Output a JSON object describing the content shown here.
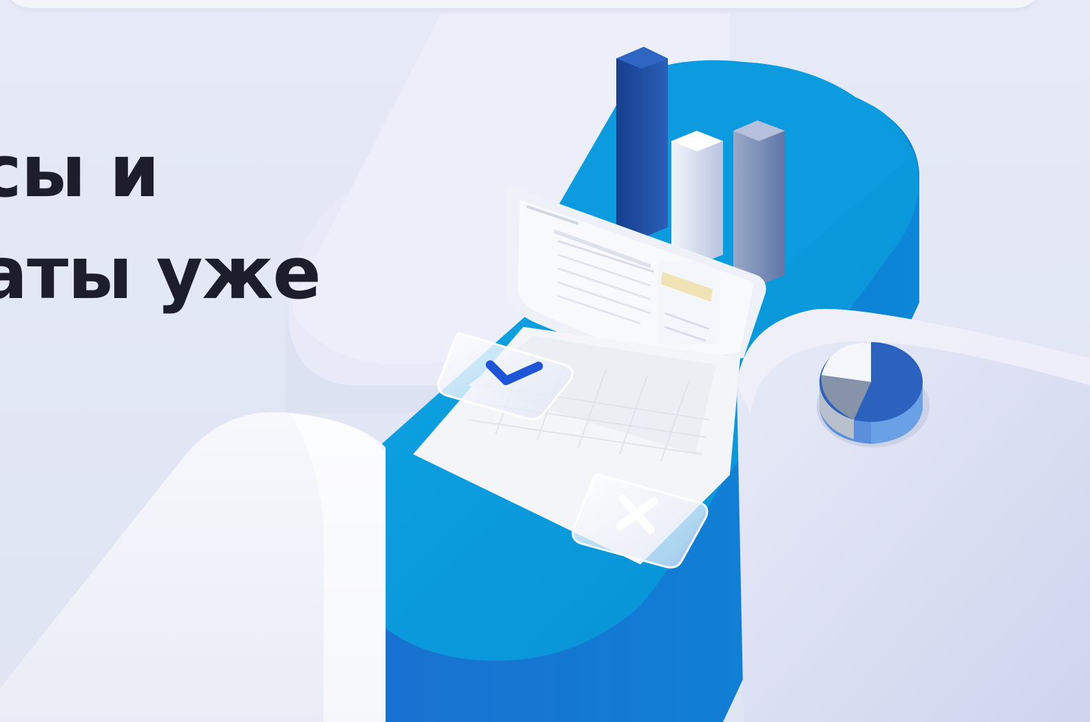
{
  "hero": {
    "headline_line1": "сы и",
    "headline_line2": "аты уже"
  },
  "colors": {
    "background": "#e3e8f5",
    "headline": "#1c1f2b",
    "accent_blue": "#0a9ee0",
    "bar_dark_blue": "#1f4fa3",
    "bar_light": "#c5cfe6",
    "bar_grey_blue": "#7b8fb8",
    "pie_blue": "#2a62bd",
    "pie_grey": "#8793a9",
    "pie_white": "#f4f6fb"
  },
  "icons": {
    "check": "check-icon",
    "close": "close-icon"
  }
}
